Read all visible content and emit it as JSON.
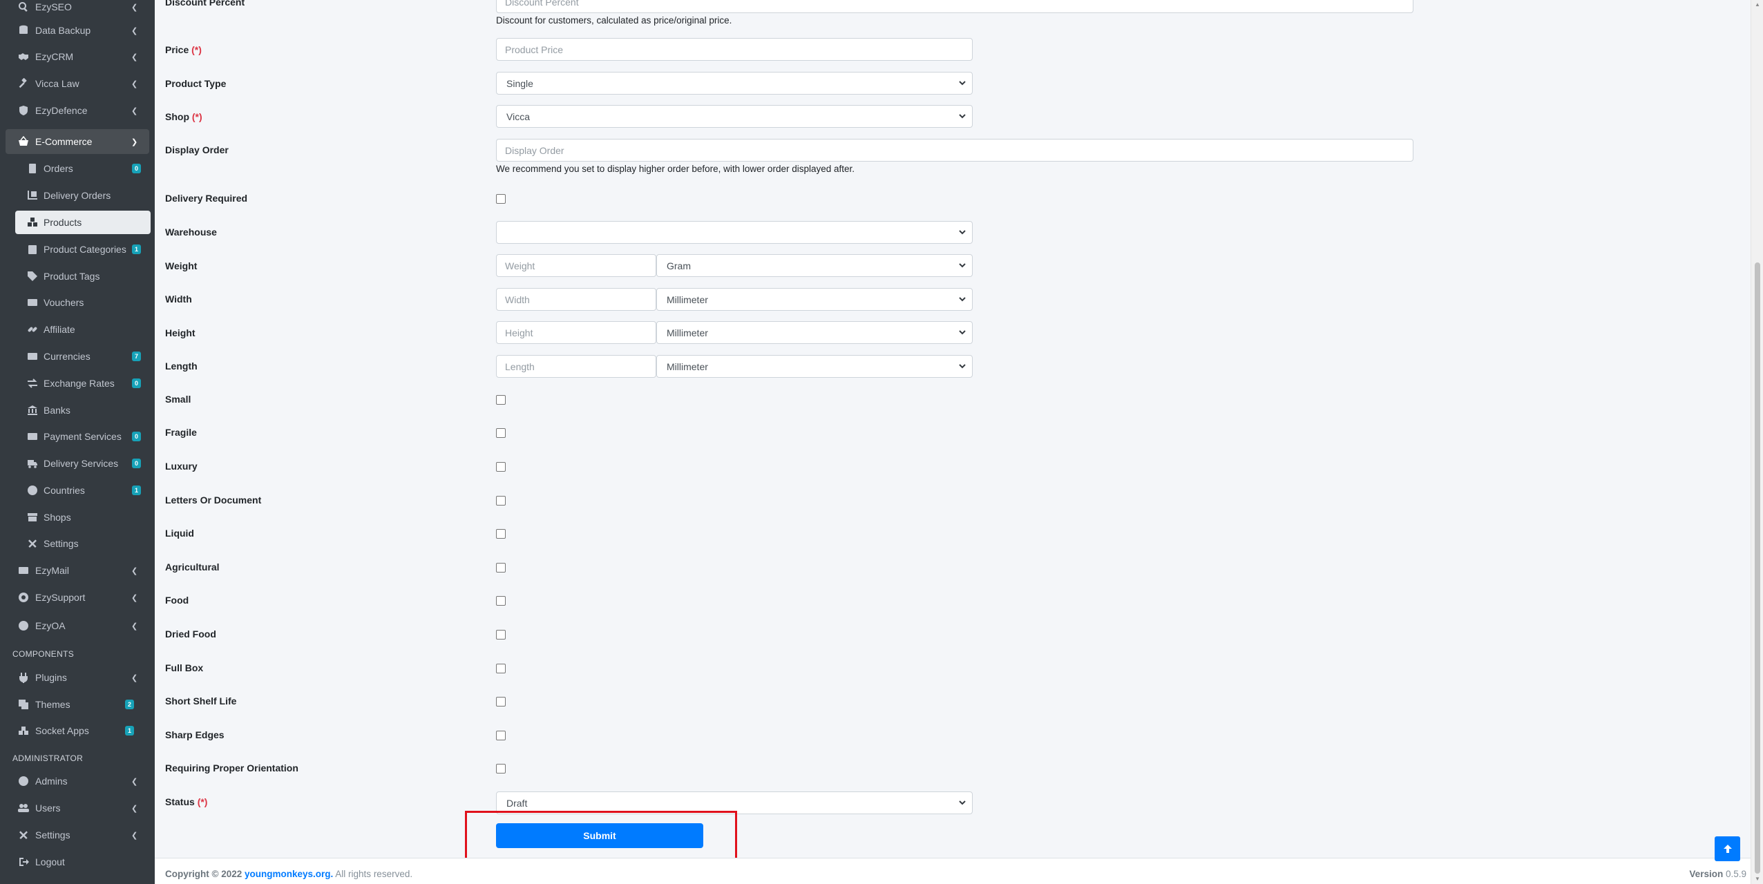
{
  "sidebar": {
    "top_items": [
      {
        "label": "EzySEO",
        "icon": "search-icon"
      },
      {
        "label": "Data Backup",
        "icon": "database-icon"
      },
      {
        "label": "EzyCRM",
        "icon": "handshake-icon"
      },
      {
        "label": "Vicca Law",
        "icon": "gavel-icon"
      },
      {
        "label": "EzyDefence",
        "icon": "shield-icon"
      },
      {
        "label": "E-Commerce",
        "icon": "basket-icon"
      }
    ],
    "ecommerce_items": [
      {
        "label": "Orders",
        "badge": "0"
      },
      {
        "label": "Delivery Orders",
        "badge": ""
      },
      {
        "label": "Products",
        "badge": ""
      },
      {
        "label": "Product Categories",
        "badge": "1"
      },
      {
        "label": "Product Tags",
        "badge": ""
      },
      {
        "label": "Vouchers",
        "badge": ""
      },
      {
        "label": "Affiliate",
        "badge": ""
      },
      {
        "label": "Currencies",
        "badge": "7"
      },
      {
        "label": "Exchange Rates",
        "badge": "0"
      },
      {
        "label": "Banks",
        "badge": ""
      },
      {
        "label": "Payment Services",
        "badge": "0"
      },
      {
        "label": "Delivery Services",
        "badge": "0"
      },
      {
        "label": "Countries",
        "badge": "1"
      },
      {
        "label": "Shops",
        "badge": ""
      },
      {
        "label": "Settings",
        "badge": ""
      }
    ],
    "more_items": [
      {
        "label": "EzyMail"
      },
      {
        "label": "EzySupport"
      },
      {
        "label": "EzyOA"
      }
    ],
    "components_header": "COMPONENTS",
    "component_items": [
      {
        "label": "Plugins",
        "badge": ""
      },
      {
        "label": "Themes",
        "badge": "2"
      },
      {
        "label": "Socket Apps",
        "badge": "1"
      }
    ],
    "administrator_header": "ADMINISTRATOR",
    "admin_items": [
      {
        "label": "Admins"
      },
      {
        "label": "Users"
      },
      {
        "label": "Settings"
      },
      {
        "label": "Logout"
      }
    ]
  },
  "form": {
    "discount": {
      "label": "Discount Percent",
      "placeholder": "Discount Percent",
      "help": "Discount for customers, calculated as price/original price."
    },
    "price": {
      "label": "Price",
      "required": "(*)",
      "placeholder": "Product Price"
    },
    "product_type": {
      "label": "Product Type",
      "value": "Single"
    },
    "shop": {
      "label": "Shop",
      "required": "(*)",
      "value": "Vicca"
    },
    "display_order": {
      "label": "Display Order",
      "placeholder": "Display Order",
      "help": "We recommend you set to display higher order before, with lower order displayed after."
    },
    "delivery_required": {
      "label": "Delivery Required"
    },
    "warehouse": {
      "label": "Warehouse",
      "value": ""
    },
    "weight": {
      "label": "Weight",
      "placeholder": "Weight",
      "unit": "Gram"
    },
    "width": {
      "label": "Width",
      "placeholder": "Width",
      "unit": "Millimeter"
    },
    "height": {
      "label": "Height",
      "placeholder": "Height",
      "unit": "Millimeter"
    },
    "length": {
      "label": "Length",
      "placeholder": "Length",
      "unit": "Millimeter"
    },
    "checkboxes": [
      "Small",
      "Fragile",
      "Luxury",
      "Letters Or Document",
      "Liquid",
      "Agricultural",
      "Food",
      "Dried Food",
      "Full Box",
      "Short Shelf Life",
      "Sharp Edges",
      "Requiring Proper Orientation"
    ],
    "status": {
      "label": "Status",
      "required": "(*)",
      "value": "Draft"
    },
    "submit_label": "Submit"
  },
  "footer": {
    "copyright_prefix": "Copyright © 2022",
    "link_text": "youngmonkeys.org.",
    "rights": "All rights reserved.",
    "version_label": "Version",
    "version_value": "0.5.9"
  },
  "colors": {
    "sidebar_bg": "#343a40",
    "primary": "#007bff",
    "badge": "#17a2b8",
    "required": "#dc3545",
    "highlight": "#e0111c"
  }
}
